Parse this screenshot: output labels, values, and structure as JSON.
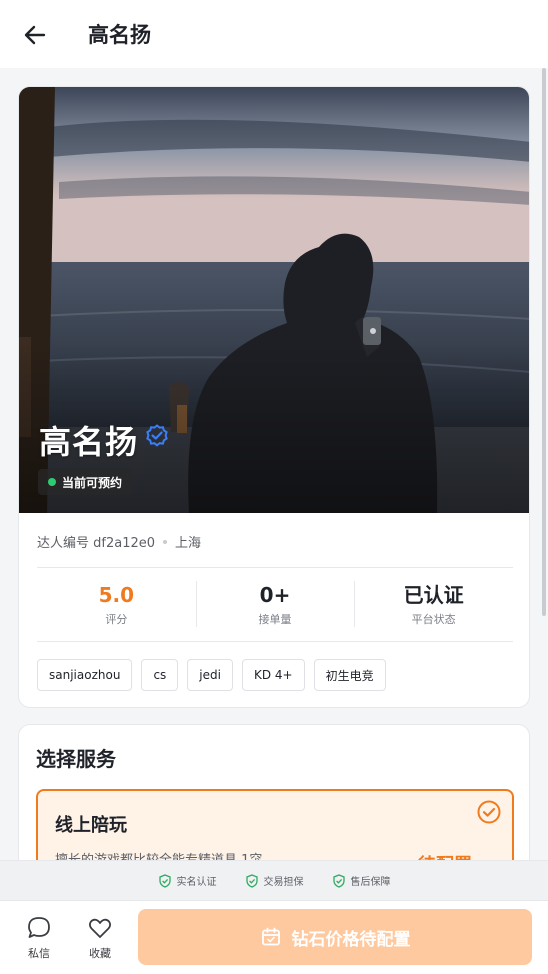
{
  "header": {
    "title": "高名扬",
    "back_icon": "arrow-left-icon"
  },
  "profile": {
    "name": "高名扬",
    "verified_icon": "verified-check-icon",
    "availability": "当前可预约",
    "id_label": "达人编号 df2a12e0",
    "location": "上海",
    "stats": [
      {
        "value": "5.0",
        "label": "评分",
        "color": "#f07b1f"
      },
      {
        "value": "0+",
        "label": "接单量",
        "color": "#1f2329"
      },
      {
        "value": "已认证",
        "label": "平台状态",
        "color": "#1f2329"
      }
    ],
    "tags": [
      "sanjiaozhou",
      "cs",
      "jedi",
      "KD 4+",
      "初生电竞"
    ]
  },
  "service": {
    "title": "选择服务",
    "option": {
      "name": "线上陪玩",
      "description": "擅长的游戏都比较全能专精道具 1突。",
      "price": "待配置",
      "selected": true
    }
  },
  "guarantees": [
    "实名认证",
    "交易担保",
    "售后保障"
  ],
  "action_bar": {
    "message_label": "私信",
    "favorite_label": "收藏",
    "primary_label": "钻石价格待配置"
  },
  "colors": {
    "accent": "#f07b1f",
    "accent_soft": "#fff3e8",
    "primary_disabled": "#ffc9a0",
    "available_dot": "#2ecc71",
    "verify_blue": "#3b7ff5",
    "guarantee_green": "#2faa62"
  }
}
